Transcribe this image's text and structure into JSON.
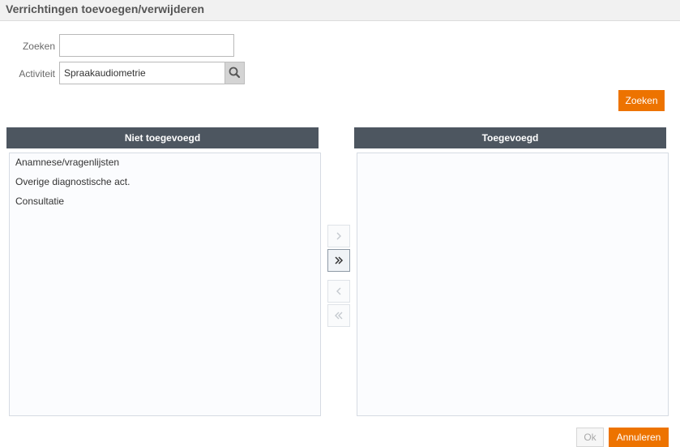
{
  "dialog": {
    "title": "Verrichtingen toevoegen/verwijderen"
  },
  "form": {
    "search_label": "Zoeken",
    "search_value": "",
    "activity_label": "Activiteit",
    "activity_value": "Spraakaudiometrie",
    "search_button": "Zoeken"
  },
  "lists": {
    "not_added": {
      "header": "Niet toegevoegd",
      "items": [
        "Anamnese/vragenlijsten",
        "Overige diagnostische act.",
        "Consultatie"
      ]
    },
    "added": {
      "header": "Toegevoegd",
      "items": []
    }
  },
  "footer": {
    "ok_label": "Ok",
    "cancel_label": "Annuleren"
  },
  "colors": {
    "accent": "#ed7300",
    "header_bg": "#4d5660"
  }
}
